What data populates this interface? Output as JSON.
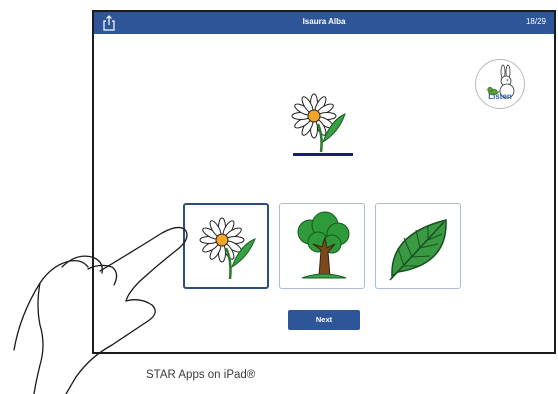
{
  "app": {
    "student_name": "Isaura Alba",
    "progress": "18/29",
    "share_icon": "share-icon"
  },
  "listen_button": {
    "label": "Listen",
    "icon": "rabbit-bird-icon"
  },
  "prompt": {
    "picture": "daisy-flower"
  },
  "choices": [
    {
      "picture": "daisy-flower",
      "selected": true
    },
    {
      "picture": "tree",
      "selected": false
    },
    {
      "picture": "leaf",
      "selected": false
    }
  ],
  "next_button": {
    "label": "Next"
  },
  "caption": "STAR Apps on iPad®",
  "colors": {
    "bar": "#2e5597",
    "underline": "#17206a",
    "selected_border": "#2e4c82"
  }
}
